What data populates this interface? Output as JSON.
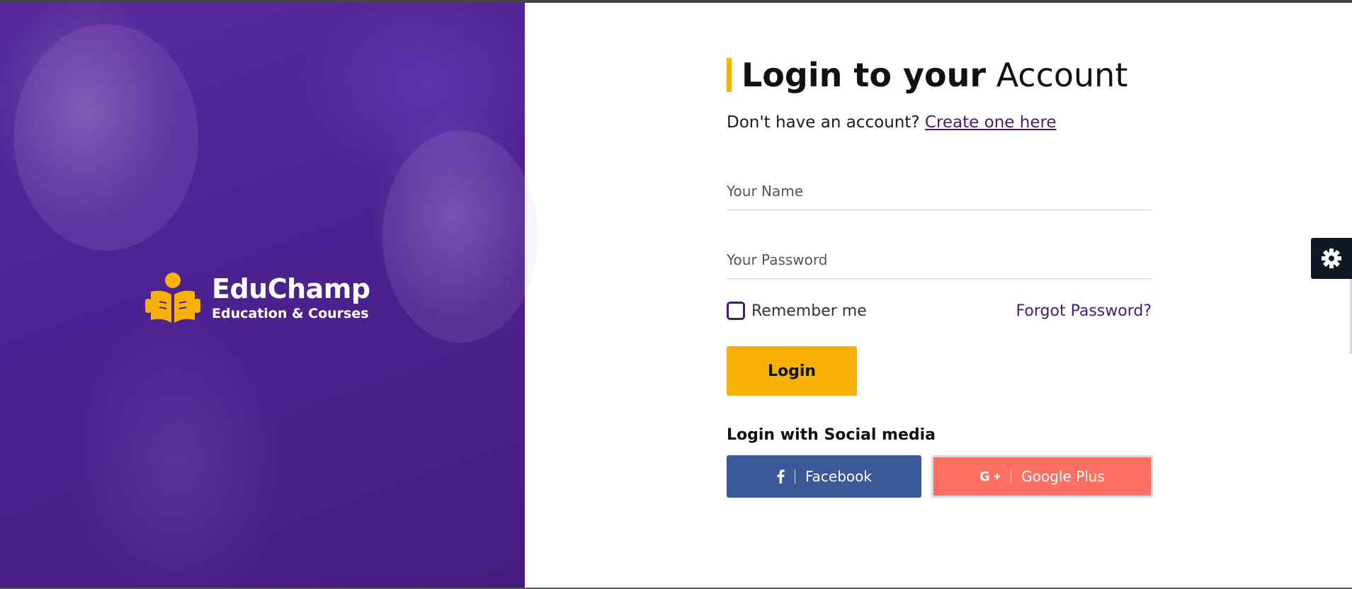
{
  "brand": {
    "name": "EduChamp",
    "tagline": "Education & Courses",
    "accent_color": "#f7b205",
    "hero_color": "#4d2394"
  },
  "login": {
    "heading_bold": "Login to your",
    "heading_light": "Account",
    "signup_prompt": "Don't have an account?",
    "signup_link": "Create one here",
    "name_placeholder": "Your Name",
    "password_placeholder": "Your Password",
    "remember_label": "Remember me",
    "forgot_label": "Forgot Password?",
    "login_button": "Login"
  },
  "social": {
    "title": "Login with Social media",
    "facebook_label": "Facebook",
    "facebook_icon": "facebook-icon",
    "facebook_color": "#3b5998",
    "google_label": "Google Plus",
    "google_icon": "google-plus-icon",
    "google_color": "#ff6f61"
  },
  "settings": {
    "icon": "gear-icon"
  }
}
